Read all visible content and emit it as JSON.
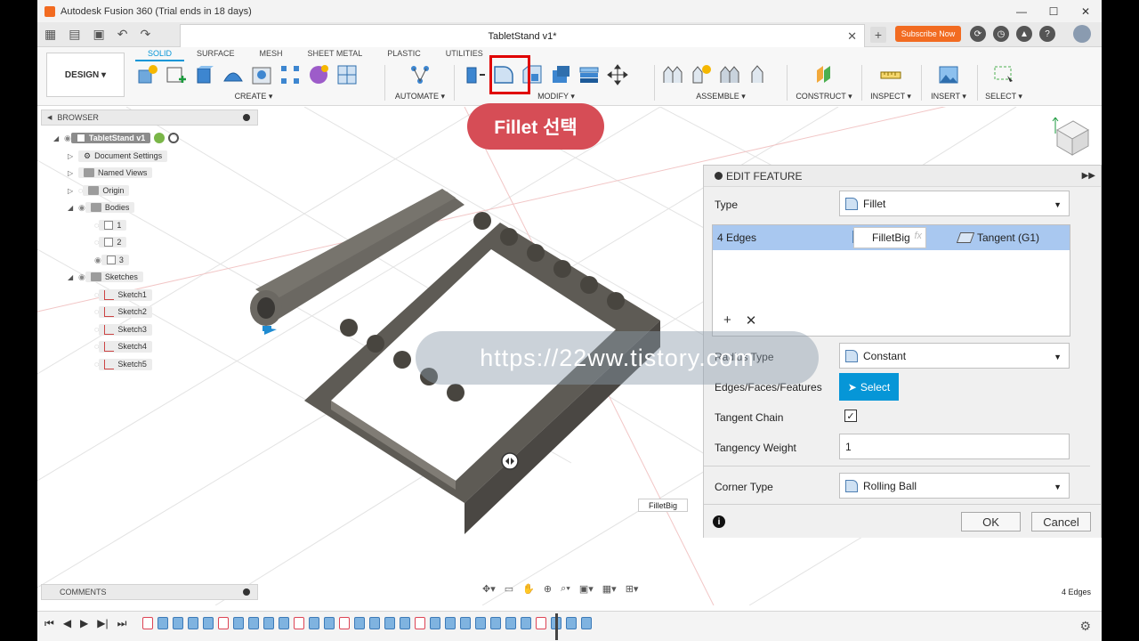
{
  "window": {
    "title": "Autodesk Fusion 360 (Trial ends in 18 days)",
    "minimize": "—",
    "maximize": "☐",
    "close": "✕"
  },
  "tabbar": {
    "doc_title": "TabletStand v1*",
    "close": "✕",
    "plus": "+",
    "subscribe": "Subscribe Now"
  },
  "toolbar": {
    "design": "DESIGN ▾",
    "tabs": [
      "SOLID",
      "SURFACE",
      "MESH",
      "SHEET METAL",
      "PLASTIC",
      "UTILITIES"
    ],
    "active_tab": "SOLID",
    "groups": {
      "create": "CREATE ▾",
      "automate": "AUTOMATE ▾",
      "modify": "MODIFY ▾",
      "assemble": "ASSEMBLE ▾",
      "construct": "CONSTRUCT ▾",
      "inspect": "INSPECT ▾",
      "insert": "INSERT ▾",
      "select": "SELECT ▾"
    }
  },
  "annotation": "Fillet 선택",
  "browser": {
    "title": "BROWSER",
    "root": "TabletStand v1",
    "items": [
      "Document Settings",
      "Named Views",
      "Origin",
      "Bodies",
      "1",
      "2",
      "3",
      "Sketches",
      "Sketch1",
      "Sketch2",
      "Sketch3",
      "Sketch4",
      "Sketch5"
    ]
  },
  "comments": "COMMENTS",
  "panel": {
    "title": "EDIT FEATURE",
    "type_label": "Type",
    "type_value": "Fillet",
    "edges_label": "4 Edges",
    "edges_name": "FilletBig",
    "edges_fx": "fx",
    "edges_tangent": "Tangent (G1)",
    "add": "+",
    "remove": "✕",
    "radius_type_label": "Radius Type",
    "radius_type_value": "Constant",
    "edges_faces_label": "Edges/Faces/Features",
    "select_btn": "Select",
    "tangent_chain_label": "Tangent Chain",
    "tangent_chain_checked": "✓",
    "tangency_weight_label": "Tangency Weight",
    "tangency_weight_value": "1",
    "corner_type_label": "Corner Type",
    "corner_type_value": "Rolling Ball",
    "ok": "OK",
    "cancel": "Cancel",
    "info": "i"
  },
  "watermark": "https://22ww.tistory.com",
  "canvas_tag": "FilletBig",
  "status_right": "4 Edges",
  "colors": {
    "accent": "#0696d7",
    "annotation": "#d64d56",
    "highlight": "#e00000",
    "brand": "#f26b21"
  }
}
